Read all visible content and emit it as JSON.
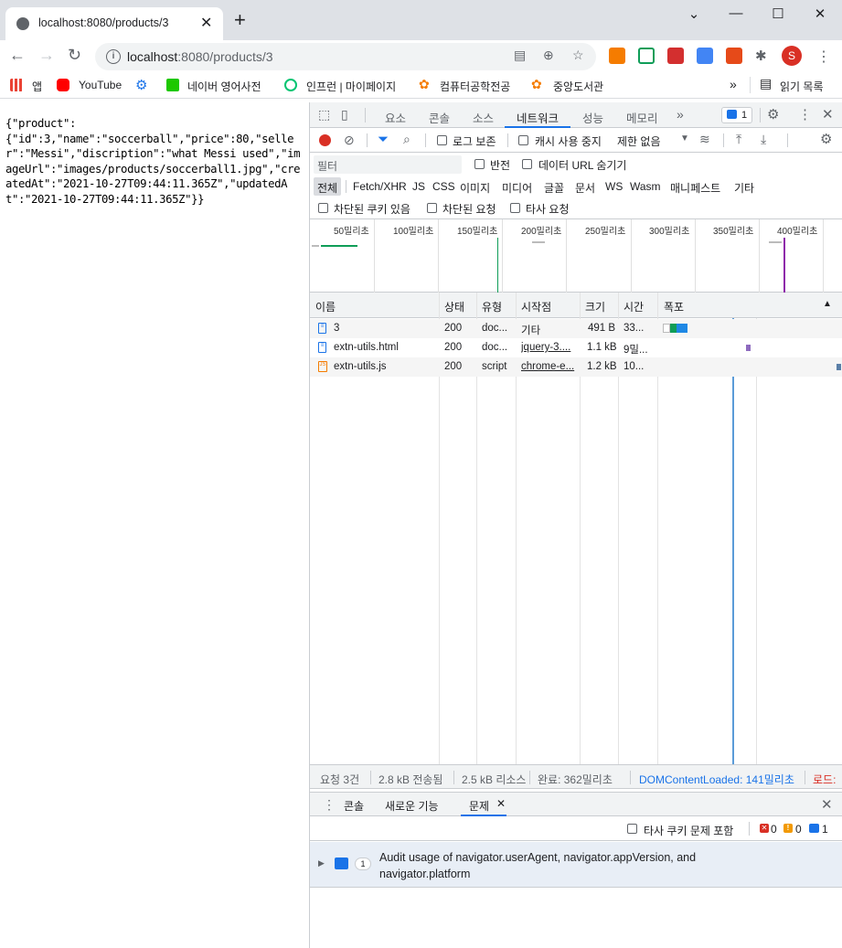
{
  "browser": {
    "tab_title": "localhost:8080/products/3",
    "url_host": "localhost",
    "url_rest": ":8080/products/3",
    "profile_initial": "S",
    "bookmarks": [
      "앱",
      "YouTube",
      "네이버 영어사전",
      "인프런 | 마이페이지",
      "컴퓨터공학전공",
      "중앙도서관"
    ],
    "reading_list": "읽기 목록"
  },
  "page": {
    "json_text": "{\"product\":\n{\"id\":3,\"name\":\"soccerball\",\"price\":80,\"seller\":\"Messi\",\"discription\":\"what Messi used\",\"imageUrl\":\"images/products/soccerball1.jpg\",\"createdAt\":\"2021-10-27T09:44:11.365Z\",\"updatedAt\":\"2021-10-27T09:44:11.365Z\"}}"
  },
  "devtools": {
    "tabs": [
      "요소",
      "콘솔",
      "소스",
      "네트워크",
      "성능",
      "메모리"
    ],
    "active_tab": "네트워크",
    "issues_badge": "1",
    "toolbar": {
      "preserve_log": "로그 보존",
      "disable_cache": "캐시 사용 중지",
      "throttle": "제한 없음"
    },
    "filter": {
      "placeholder": "필터",
      "invert": "반전",
      "hide_data_urls": "데이터 URL 숨기기",
      "types": [
        "전체",
        "Fetch/XHR",
        "JS",
        "CSS",
        "이미지",
        "미디어",
        "글꼴",
        "문서",
        "WS",
        "Wasm",
        "매니페스트",
        "기타"
      ],
      "blocked_cookies": "차단된 쿠키 있음",
      "blocked_requests": "차단된 요청",
      "third_party": "타사 요청"
    },
    "timeline_ticks": [
      "50밀리초",
      "100밀리초",
      "150밀리초",
      "200밀리초",
      "250밀리초",
      "300밀리초",
      "350밀리초",
      "400밀리초"
    ],
    "columns": [
      "이름",
      "상태",
      "유형",
      "시작점",
      "크기",
      "시간",
      "폭포"
    ],
    "requests": [
      {
        "name": "3",
        "status": "200",
        "type": "doc...",
        "initiator": "기타",
        "size": "491 B",
        "time": "33..."
      },
      {
        "name": "extn-utils.html",
        "status": "200",
        "type": "doc...",
        "initiator": "jquery-3....",
        "size": "1.1 kB",
        "time": "9밀..."
      },
      {
        "name": "extn-utils.js",
        "status": "200",
        "type": "script",
        "initiator": "chrome-e...",
        "size": "1.2 kB",
        "time": "10..."
      }
    ],
    "status_bar": {
      "requests": "요청 3건",
      "transferred": "2.8 kB 전송됨",
      "resources": "2.5 kB 리소스",
      "finish": "완료: 362밀리초",
      "dcl": "DOMContentLoaded: 141밀리초",
      "load": "로드:"
    },
    "drawer": {
      "tabs": [
        "콘솔",
        "새로운 기능",
        "문제"
      ],
      "active_tab": "문제",
      "third_party_cookie": "타사 쿠키 문제 포함",
      "errors": "0",
      "warnings": "0",
      "infos": "1",
      "issue_count": "1",
      "issue_text": "Audit usage of navigator.userAgent, navigator.appVersion, and navigator.platform"
    },
    "colors": {
      "accent": "#1a73e8",
      "record": "#d93025"
    }
  }
}
